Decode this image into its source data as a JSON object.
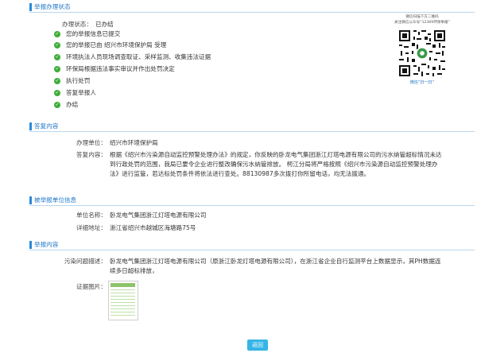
{
  "section1": {
    "title": "举报办理状态",
    "status_label": "办理状态：",
    "status_value": "已办结",
    "steps": [
      "您的举报信息已提交",
      "您的举报已由 绍兴市环境保护局 受理",
      "环境执法人员现场调查取证、采样监测、收集违法证据",
      "环保局根据违法事实审议并作出处罚决定",
      "执行处罚",
      "答复举报人",
      "办结"
    ]
  },
  "qr": {
    "caption1": "微信扫描下方二维码",
    "caption2": "关注微信公众号“12369环保举报”",
    "footer": "微信“扫一扫”"
  },
  "section2": {
    "title": "答复内容",
    "unit_label": "办理单位：",
    "unit_value": "绍兴市环境保护局",
    "reply_label": "答复内容：",
    "reply_text": "根据《绍兴市污染源自动监控预警处理办法》的规定，你反映的卧龙电气集团浙江灯塔电源有限公司的污水纳管超标情况未达到行政处罚的范围，我局已要令企业进行整改确保污水纳管排放。 柯江分局将严格按照《绍兴市污染源自动监控预警处理办法》进行监管，若达标处罚条件将依法进行查处。88130987多次拨打你所留电话，均无法拨通。"
  },
  "section3": {
    "title": "被举报单位信息",
    "name_label": "单位名称：",
    "name_value": "卧龙电气集团浙江灯塔电源有限公司",
    "addr_label": "详细地址：",
    "addr_value": "浙江省绍兴市越城区海塘路75号"
  },
  "section4": {
    "title": "举报内容",
    "desc_label": "污染问题描述：",
    "desc_text": "卧龙电气集团浙江灯塔电源有限公司（原浙江卧龙灯塔电源有限公司），在浙江省企业自行监测平台上数据显示，其PH数据连续多日超标排放，",
    "img_label": "证据图片："
  },
  "back_button": "返回"
}
